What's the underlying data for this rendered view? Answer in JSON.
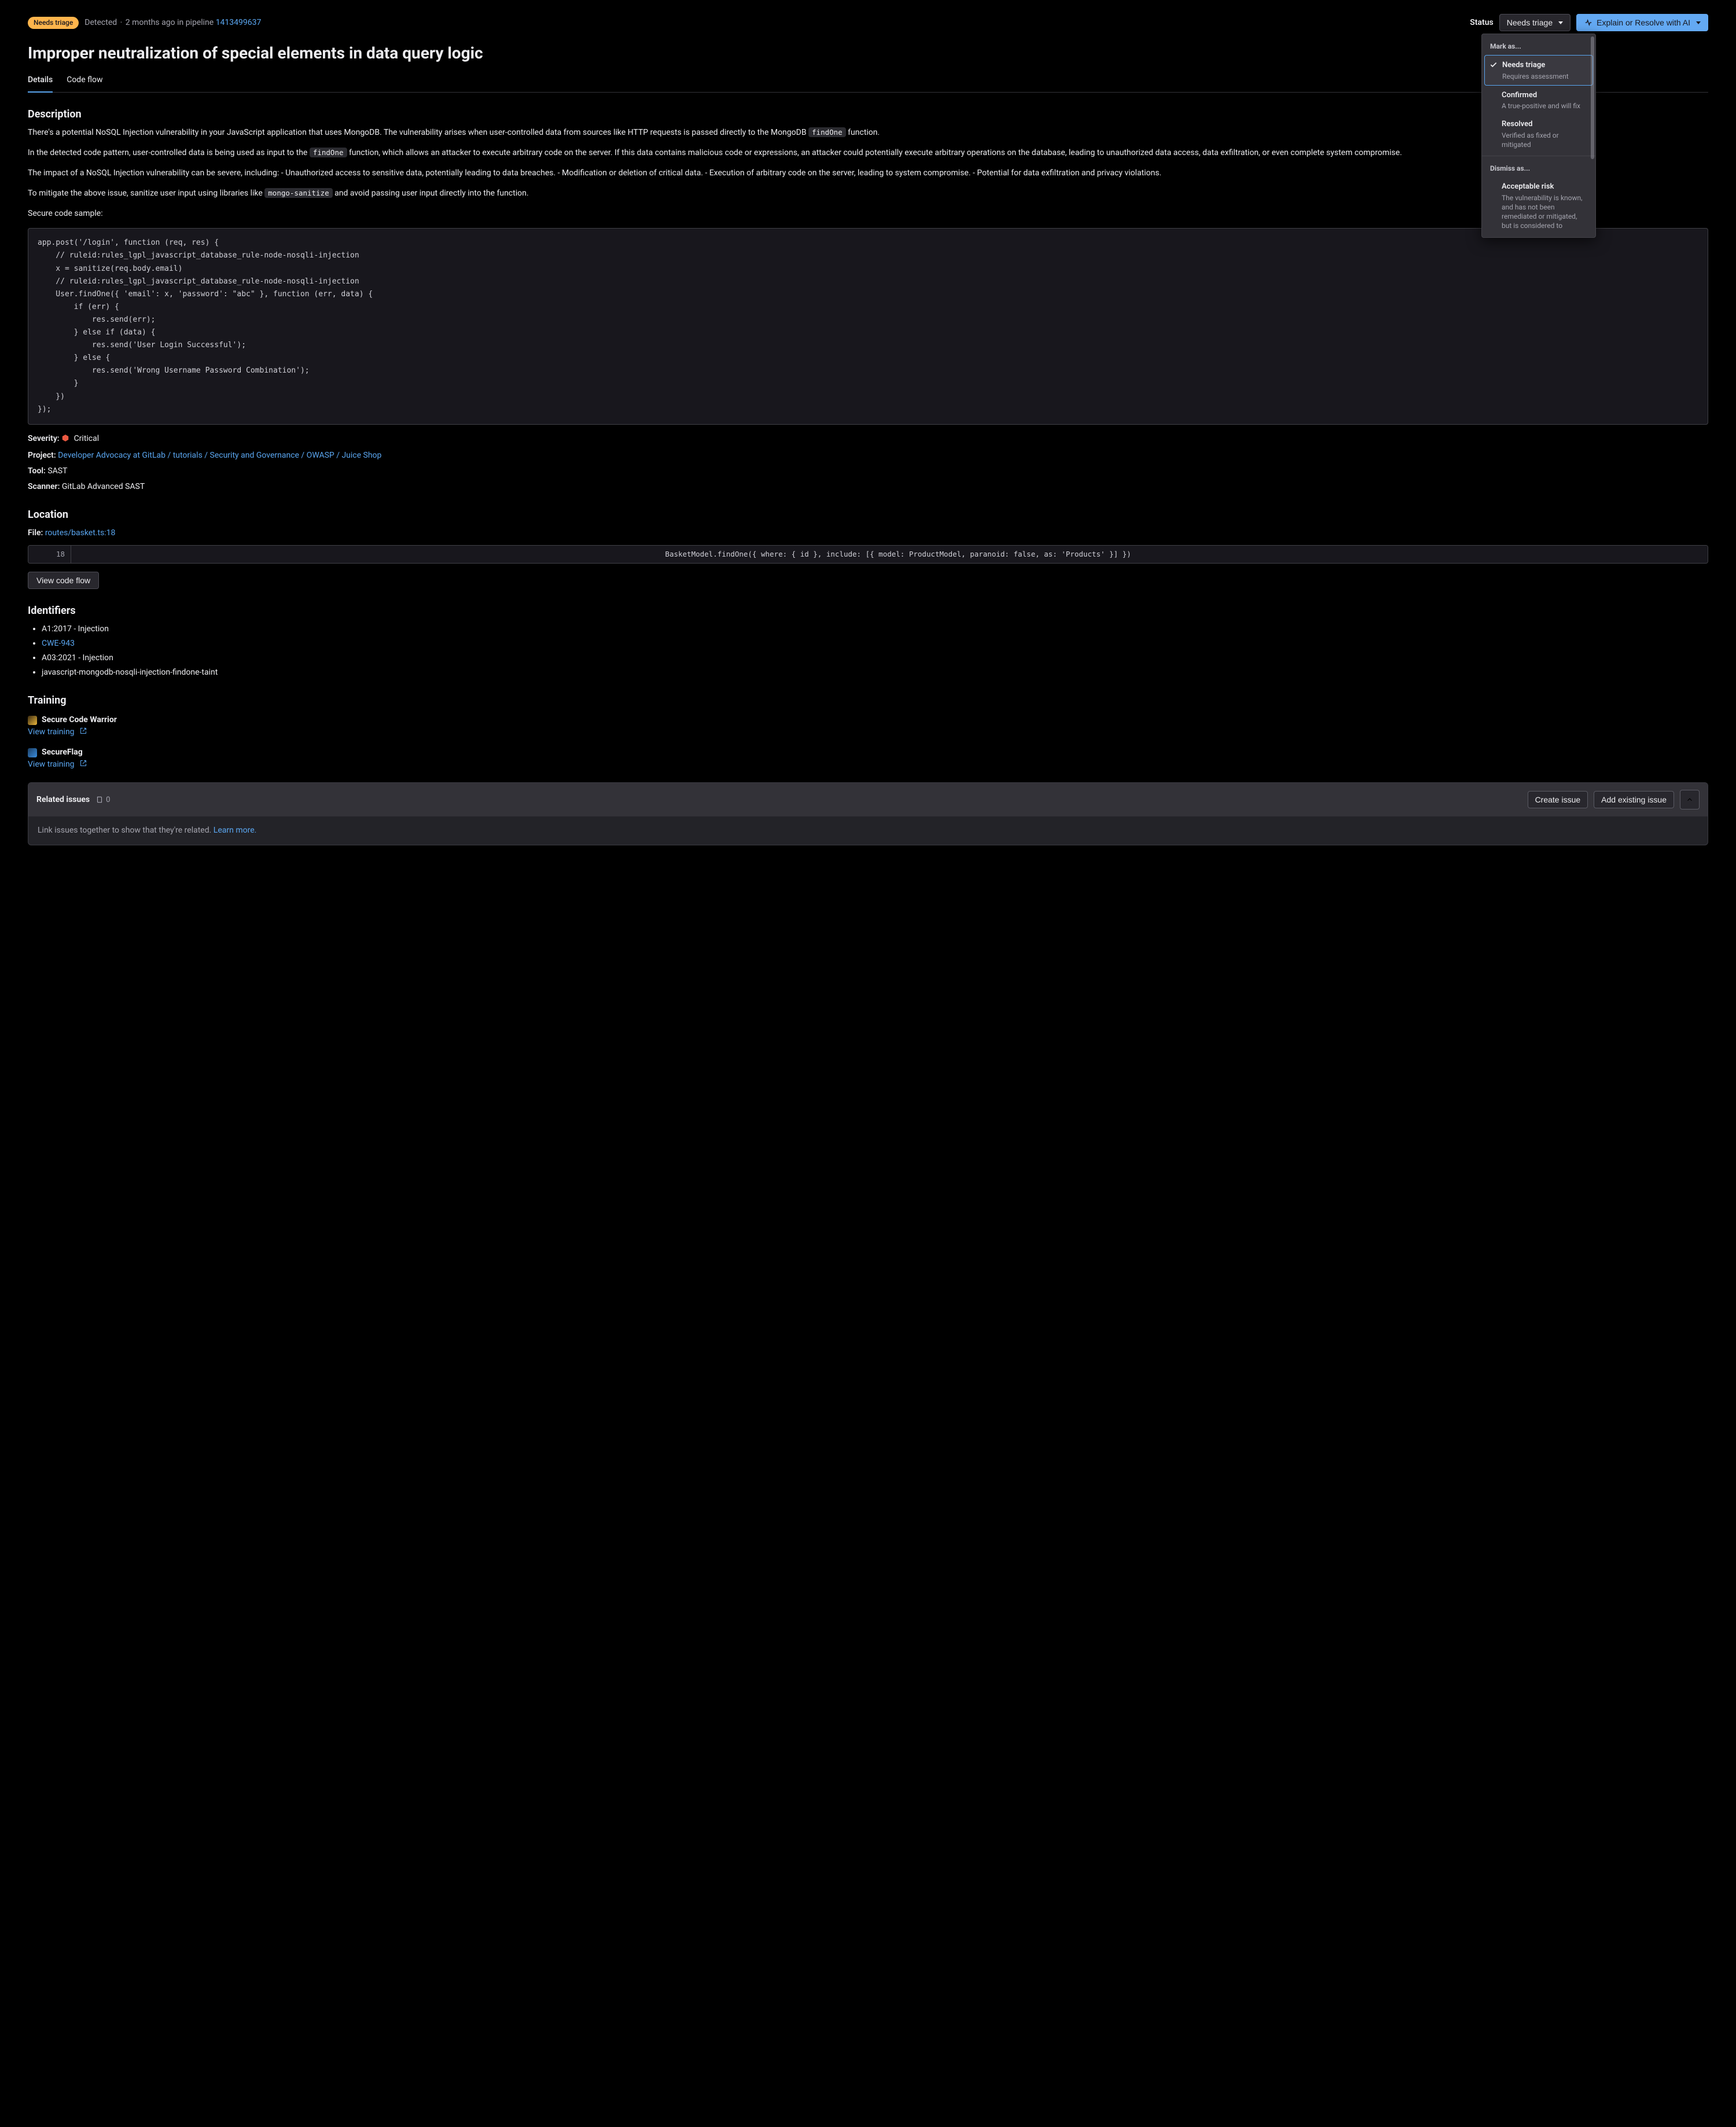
{
  "header": {
    "badge": "Needs triage",
    "detected_prefix": "Detected",
    "sep": "·",
    "time_ago": "2 months ago",
    "in_label": "in",
    "pipeline_label": "pipeline",
    "pipeline_id": "1413499637",
    "status_label": "Status",
    "status_value": "Needs triage",
    "ai_button": "Explain or Resolve with AI"
  },
  "title": "Improper neutralization of special elements in data query logic",
  "tabs": {
    "details": "Details",
    "codeflow": "Code flow"
  },
  "status_menu": {
    "mark_as": "Mark as...",
    "dismiss_as": "Dismiss as...",
    "items_mark": [
      {
        "title": "Needs triage",
        "sub": "Requires assessment",
        "selected": true
      },
      {
        "title": "Confirmed",
        "sub": "A true-positive and will fix",
        "selected": false
      },
      {
        "title": "Resolved",
        "sub": "Verified as fixed or mitigated",
        "selected": false
      }
    ],
    "items_dismiss": [
      {
        "title": "Acceptable risk",
        "sub": "The vulnerability is known, and has not been remediated or mitigated, but is considered to",
        "selected": false
      }
    ]
  },
  "sections": {
    "description": "Description",
    "location": "Location",
    "identifiers": "Identifiers",
    "training": "Training"
  },
  "desc": {
    "p1a": "There's a potential NoSQL Injection vulnerability in your JavaScript application that uses MongoDB. The vulnerability arises when user-controlled data from sources like HTTP requests is passed directly to the MongoDB ",
    "p1code": "findOne",
    "p1b": " function.",
    "p2a": "In the detected code pattern, user-controlled data is being used as input to the ",
    "p2code": "findOne",
    "p2b": " function, which allows an attacker to execute arbitrary code on the server. If this data contains malicious code or expressions, an attacker could potentially execute arbitrary operations on the database, leading to unauthorized data access, data exfiltration, or even complete system compromise.",
    "p3": "The impact of a NoSQL Injection vulnerability can be severe, including: - Unauthorized access to sensitive data, potentially leading to data breaches. - Modification or deletion of critical data. - Execution of arbitrary code on the server, leading to system compromise. - Potential for data exfiltration and privacy violations.",
    "p4a": "To mitigate the above issue, sanitize user input using libraries like ",
    "p4code": "mongo-sanitize",
    "p4b": " and avoid passing user input directly into the function.",
    "sample_label": "Secure code sample:",
    "code": "app.post('/login', function (req, res) {\n    // ruleid:rules_lgpl_javascript_database_rule-node-nosqli-injection\n    x = sanitize(req.body.email)\n    // ruleid:rules_lgpl_javascript_database_rule-node-nosqli-injection\n    User.findOne({ 'email': x, 'password': \"abc\" }, function (err, data) {\n        if (err) {\n            res.send(err);\n        } else if (data) {\n            res.send('User Login Successful');\n        } else {\n            res.send('Wrong Username Password Combination');\n        }\n    })\n});"
  },
  "meta": {
    "severity_label": "Severity:",
    "severity_value": "Critical",
    "project_label": "Project:",
    "project_value": "Developer Advocacy at GitLab / tutorials / Security and Governance / OWASP / Juice Shop",
    "tool_label": "Tool:",
    "tool_value": "SAST",
    "scanner_label": "Scanner:",
    "scanner_value": "GitLab Advanced SAST"
  },
  "location": {
    "file_label": "File:",
    "file_link": "routes/basket.ts:18",
    "line_number": "18",
    "line_code": "    BasketModel.findOne({ where: { id }, include: [{ model: ProductModel, paranoid: false, as: 'Products' }] })",
    "view_flow_btn": "View code flow"
  },
  "identifiers": [
    {
      "text": "A1:2017 - Injection",
      "link": false
    },
    {
      "text": "CWE-943",
      "link": true
    },
    {
      "text": "A03:2021 - Injection",
      "link": false
    },
    {
      "text": "javascript-mongodb-nosqli-injection-findone-taint",
      "link": false
    }
  ],
  "training": [
    {
      "name": "Secure Code Warrior",
      "icon_color": "#ecb73c",
      "link": "View training"
    },
    {
      "name": "SecureFlag",
      "icon_color": "#3a8dde",
      "link": "View training"
    }
  ],
  "related": {
    "title": "Related issues",
    "count": "0",
    "create_btn": "Create issue",
    "add_btn": "Add existing issue",
    "body_text": "Link issues together to show that they're related. ",
    "learn_more": "Learn more."
  }
}
